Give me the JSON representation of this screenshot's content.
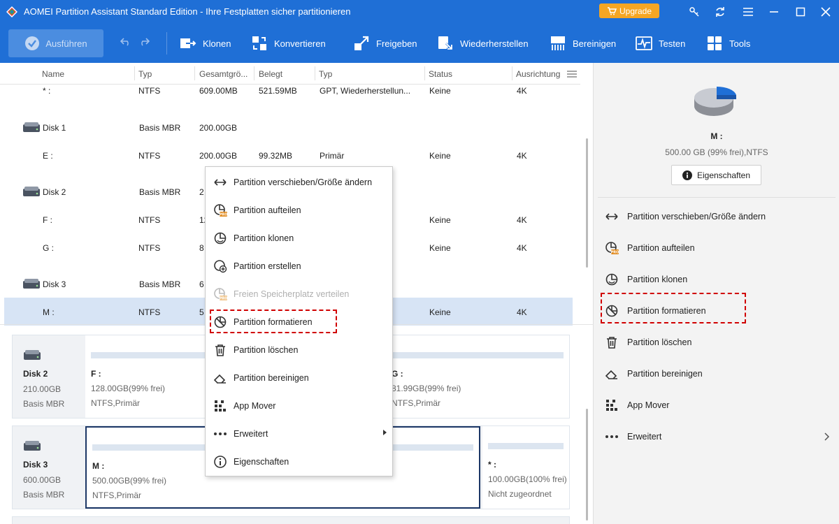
{
  "window": {
    "title": "AOMEI Partition Assistant Standard Edition - Ihre Festplatten sicher partitionieren",
    "upgrade_label": "Upgrade"
  },
  "toolbar": {
    "run_label": "Ausführen",
    "tools": [
      {
        "label": "Klonen",
        "icon": "clone-icon"
      },
      {
        "label": "Konvertieren",
        "icon": "convert-icon"
      },
      {
        "label": "Freigeben",
        "icon": "free-up-icon"
      },
      {
        "label": "Wiederherstellen",
        "icon": "recover-icon"
      },
      {
        "label": "Bereinigen",
        "icon": "wipe-icon"
      },
      {
        "label": "Testen",
        "icon": "test-icon"
      },
      {
        "label": "Tools",
        "icon": "tools-icon"
      }
    ]
  },
  "table": {
    "columns": [
      "Name",
      "Typ",
      "Gesamtgrö...",
      "Belegt",
      "Typ",
      "Status",
      "Ausrichtung"
    ],
    "rows": [
      {
        "name": "* :",
        "fs": "NTFS",
        "size": "609.00MB",
        "used": "521.59MB",
        "type": "GPT, Wiederherstellun...",
        "status": "Keine",
        "align": "4K",
        "is_disk": false
      },
      {
        "name": "Disk 1",
        "fs": "Basis MBR",
        "size": "200.00GB",
        "used": "",
        "type": "",
        "status": "",
        "align": "",
        "is_disk": true
      },
      {
        "name": "E :",
        "fs": "NTFS",
        "size": "200.00GB",
        "used": "99.32MB",
        "type": "Primär",
        "status": "Keine",
        "align": "4K",
        "is_disk": false
      },
      {
        "name": "Disk 2",
        "fs": "Basis MBR",
        "size": "2",
        "used": "",
        "type": "",
        "status": "",
        "align": "",
        "is_disk": true
      },
      {
        "name": "F :",
        "fs": "NTFS",
        "size": "12",
        "used": "",
        "type": "",
        "status": "Keine",
        "align": "4K",
        "is_disk": false
      },
      {
        "name": "G :",
        "fs": "NTFS",
        "size": "8",
        "used": "",
        "type": "",
        "status": "Keine",
        "align": "4K",
        "is_disk": false
      },
      {
        "name": "Disk 3",
        "fs": "Basis MBR",
        "size": "6",
        "used": "",
        "type": "",
        "status": "",
        "align": "",
        "is_disk": true
      },
      {
        "name": "M :",
        "fs": "NTFS",
        "size": "5",
        "used": "",
        "type": "",
        "status": "Keine",
        "align": "4K",
        "is_disk": false,
        "selected": true
      }
    ]
  },
  "disk_map": [
    {
      "name": "Disk 2",
      "size": "210.00GB",
      "type": "Basis MBR",
      "partitions": [
        {
          "label": "F :",
          "detail": "128.00GB(99% frei)",
          "fs": "NTFS,Primär"
        },
        {
          "label": "G :",
          "detail": "81.99GB(99% frei)",
          "fs": "NTFS,Primär"
        }
      ]
    },
    {
      "name": "Disk 3",
      "size": "600.00GB",
      "type": "Basis MBR",
      "partitions": [
        {
          "label": "M :",
          "detail": "500.00GB(99% frei)",
          "fs": "NTFS,Primär"
        },
        {
          "label": "* :",
          "detail": "100.00GB(100% frei)",
          "fs": "Nicht zugeordnet"
        }
      ]
    }
  ],
  "context_menu": {
    "items": [
      {
        "label": "Partition verschieben/Größe ändern",
        "icon": "resize-icon"
      },
      {
        "label": "Partition aufteilen",
        "icon": "split-pro-icon"
      },
      {
        "label": "Partition klonen",
        "icon": "clone-partition-icon"
      },
      {
        "label": "Partition erstellen",
        "icon": "create-partition-icon"
      },
      {
        "label": "Freien Speicherplatz verteilen",
        "icon": "allocate-pro-icon",
        "disabled": true
      },
      {
        "label": "Partition formatieren",
        "icon": "format-icon"
      },
      {
        "label": "Partition löschen",
        "icon": "trash-icon"
      },
      {
        "label": "Partition bereinigen",
        "icon": "eraser-icon"
      },
      {
        "label": "App Mover",
        "icon": "app-mover-icon"
      },
      {
        "label": "Erweitert",
        "icon": "more-icon",
        "submenu": true
      },
      {
        "label": "Eigenschaften",
        "icon": "info-icon"
      }
    ]
  },
  "right_panel": {
    "selected_name": "M :",
    "selected_info": "500.00 GB (99% frei),NTFS",
    "properties_label": "Eigenschaften",
    "actions": [
      {
        "label": "Partition verschieben/Größe ändern",
        "icon": "resize-icon"
      },
      {
        "label": "Partition aufteilen",
        "icon": "split-pro-icon"
      },
      {
        "label": "Partition klonen",
        "icon": "clone-partition-icon"
      },
      {
        "label": "Partition formatieren",
        "icon": "format-icon"
      },
      {
        "label": "Partition löschen",
        "icon": "trash-icon"
      },
      {
        "label": "Partition bereinigen",
        "icon": "eraser-icon"
      },
      {
        "label": "App Mover",
        "icon": "app-mover-icon"
      },
      {
        "label": "Erweitert",
        "icon": "more-icon"
      }
    ]
  },
  "colors": {
    "titlebar": "#1f6fd6",
    "upgrade": "#f5a623",
    "highlight": "#d00000",
    "selected_row": "#d7e4f5"
  }
}
